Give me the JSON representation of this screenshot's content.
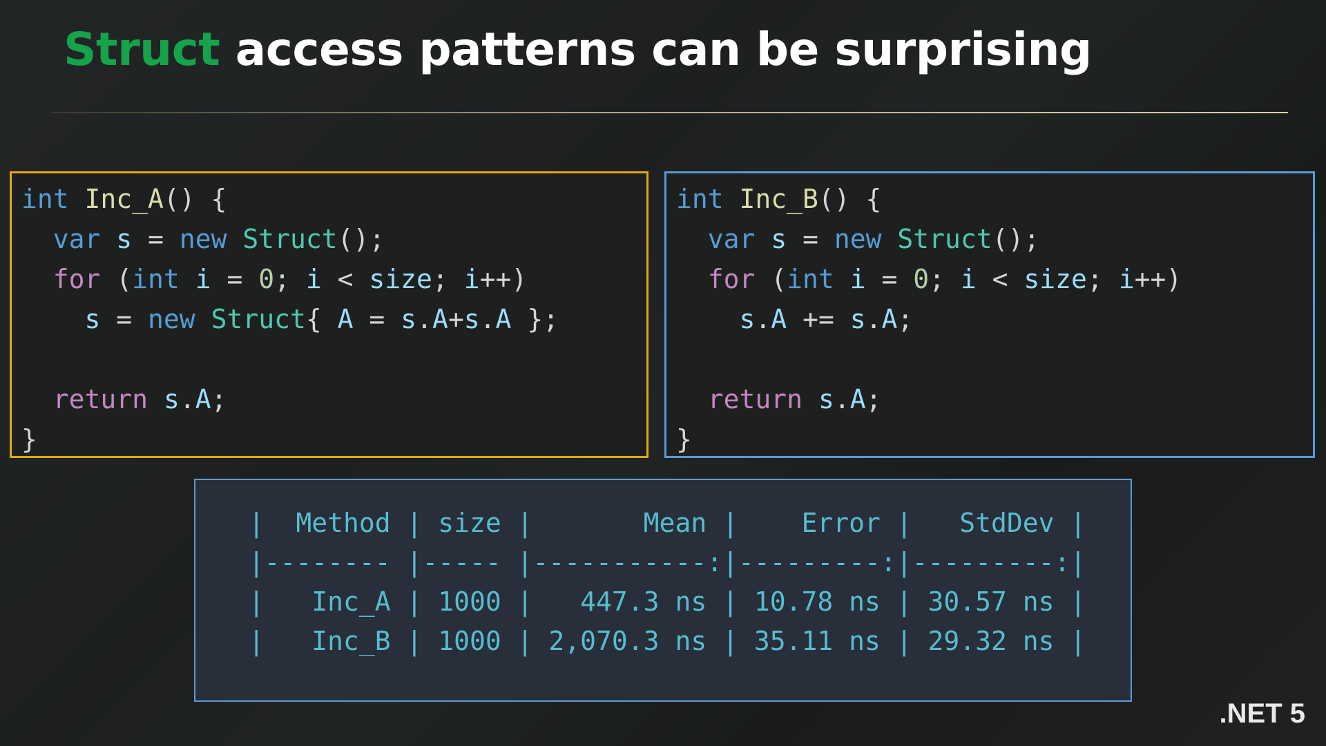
{
  "slide": {
    "background_color": "#1d1f20",
    "title": {
      "accent_text": "Struct",
      "rest_text": " access patterns can be surprising",
      "accent_color": "#16a34a",
      "text_color": "#ffffff"
    },
    "brand": ".NET 5"
  },
  "code_left": {
    "border_color": "#e3a712",
    "method_name": "Inc_A",
    "lines": [
      {
        "parts": [
          {
            "t": "int",
            "c": "kw"
          },
          {
            "t": " ",
            "c": "pun"
          },
          {
            "t": "Inc_A",
            "c": "fn"
          },
          {
            "t": "() {",
            "c": "pun"
          }
        ]
      },
      {
        "parts": [
          {
            "t": "  ",
            "c": "pun"
          },
          {
            "t": "var",
            "c": "kw"
          },
          {
            "t": " ",
            "c": "pun"
          },
          {
            "t": "s",
            "c": "id"
          },
          {
            "t": " = ",
            "c": "pun"
          },
          {
            "t": "new",
            "c": "kw"
          },
          {
            "t": " ",
            "c": "pun"
          },
          {
            "t": "Struct",
            "c": "type"
          },
          {
            "t": "();",
            "c": "pun"
          }
        ]
      },
      {
        "parts": [
          {
            "t": "  ",
            "c": "pun"
          },
          {
            "t": "for",
            "c": "ctl"
          },
          {
            "t": " (",
            "c": "pun"
          },
          {
            "t": "int",
            "c": "kw"
          },
          {
            "t": " ",
            "c": "pun"
          },
          {
            "t": "i",
            "c": "id"
          },
          {
            "t": " = ",
            "c": "pun"
          },
          {
            "t": "0",
            "c": "num"
          },
          {
            "t": "; ",
            "c": "pun"
          },
          {
            "t": "i",
            "c": "id"
          },
          {
            "t": " < ",
            "c": "pun"
          },
          {
            "t": "size",
            "c": "id"
          },
          {
            "t": "; ",
            "c": "pun"
          },
          {
            "t": "i",
            "c": "id"
          },
          {
            "t": "++)",
            "c": "pun"
          }
        ]
      },
      {
        "parts": [
          {
            "t": "    ",
            "c": "pun"
          },
          {
            "t": "s",
            "c": "id"
          },
          {
            "t": " = ",
            "c": "pun"
          },
          {
            "t": "new",
            "c": "kw"
          },
          {
            "t": " ",
            "c": "pun"
          },
          {
            "t": "Struct",
            "c": "type"
          },
          {
            "t": "{ ",
            "c": "pun"
          },
          {
            "t": "A",
            "c": "id"
          },
          {
            "t": " = ",
            "c": "pun"
          },
          {
            "t": "s",
            "c": "id"
          },
          {
            "t": ".",
            "c": "pun"
          },
          {
            "t": "A",
            "c": "id"
          },
          {
            "t": "+",
            "c": "pun"
          },
          {
            "t": "s",
            "c": "id"
          },
          {
            "t": ".",
            "c": "pun"
          },
          {
            "t": "A",
            "c": "id"
          },
          {
            "t": " };",
            "c": "pun"
          }
        ]
      },
      {
        "parts": [
          {
            "t": "",
            "c": "pun"
          }
        ]
      },
      {
        "parts": [
          {
            "t": "  ",
            "c": "pun"
          },
          {
            "t": "return",
            "c": "ctl"
          },
          {
            "t": " ",
            "c": "pun"
          },
          {
            "t": "s",
            "c": "id"
          },
          {
            "t": ".",
            "c": "pun"
          },
          {
            "t": "A",
            "c": "id"
          },
          {
            "t": ";",
            "c": "pun"
          }
        ]
      },
      {
        "parts": [
          {
            "t": "}",
            "c": "pun"
          }
        ]
      }
    ]
  },
  "code_right": {
    "border_color": "#5b9bd5",
    "method_name": "Inc_B",
    "lines": [
      {
        "parts": [
          {
            "t": "int",
            "c": "kw"
          },
          {
            "t": " ",
            "c": "pun"
          },
          {
            "t": "Inc_B",
            "c": "fn"
          },
          {
            "t": "() {",
            "c": "pun"
          }
        ]
      },
      {
        "parts": [
          {
            "t": "  ",
            "c": "pun"
          },
          {
            "t": "var",
            "c": "kw"
          },
          {
            "t": " ",
            "c": "pun"
          },
          {
            "t": "s",
            "c": "id"
          },
          {
            "t": " = ",
            "c": "pun"
          },
          {
            "t": "new",
            "c": "kw"
          },
          {
            "t": " ",
            "c": "pun"
          },
          {
            "t": "Struct",
            "c": "type"
          },
          {
            "t": "();",
            "c": "pun"
          }
        ]
      },
      {
        "parts": [
          {
            "t": "  ",
            "c": "pun"
          },
          {
            "t": "for",
            "c": "ctl"
          },
          {
            "t": " (",
            "c": "pun"
          },
          {
            "t": "int",
            "c": "kw"
          },
          {
            "t": " ",
            "c": "pun"
          },
          {
            "t": "i",
            "c": "id"
          },
          {
            "t": " = ",
            "c": "pun"
          },
          {
            "t": "0",
            "c": "num"
          },
          {
            "t": "; ",
            "c": "pun"
          },
          {
            "t": "i",
            "c": "id"
          },
          {
            "t": " < ",
            "c": "pun"
          },
          {
            "t": "size",
            "c": "id"
          },
          {
            "t": "; ",
            "c": "pun"
          },
          {
            "t": "i",
            "c": "id"
          },
          {
            "t": "++)",
            "c": "pun"
          }
        ]
      },
      {
        "parts": [
          {
            "t": "    ",
            "c": "pun"
          },
          {
            "t": "s",
            "c": "id"
          },
          {
            "t": ".",
            "c": "pun"
          },
          {
            "t": "A",
            "c": "id"
          },
          {
            "t": " += ",
            "c": "pun"
          },
          {
            "t": "s",
            "c": "id"
          },
          {
            "t": ".",
            "c": "pun"
          },
          {
            "t": "A",
            "c": "id"
          },
          {
            "t": ";",
            "c": "pun"
          }
        ]
      },
      {
        "parts": [
          {
            "t": "",
            "c": "pun"
          }
        ]
      },
      {
        "parts": [
          {
            "t": "  ",
            "c": "pun"
          },
          {
            "t": "return",
            "c": "ctl"
          },
          {
            "t": " ",
            "c": "pun"
          },
          {
            "t": "s",
            "c": "id"
          },
          {
            "t": ".",
            "c": "pun"
          },
          {
            "t": "A",
            "c": "id"
          },
          {
            "t": ";",
            "c": "pun"
          }
        ]
      },
      {
        "parts": [
          {
            "t": "}",
            "c": "pun"
          }
        ]
      }
    ]
  },
  "benchmark": {
    "border_color": "#5b9bd5",
    "background_color": "#282e3a",
    "text_color": "#55bece",
    "columns": [
      "Method",
      "size",
      "Mean",
      "Error",
      "StdDev"
    ],
    "separator_row": [
      "-------",
      "-----",
      "-----------:",
      "---------:",
      "---------:"
    ],
    "rows": [
      {
        "Method": "Inc_A",
        "size": "1000",
        "Mean": "447.3 ns",
        "Error": "10.78 ns",
        "StdDev": "30.57 ns"
      },
      {
        "Method": "Inc_B",
        "size": "1000",
        "Mean": "2,070.3 ns",
        "Error": "35.11 ns",
        "StdDev": "29.32 ns"
      }
    ],
    "rendered_text": "|  Method | size |       Mean |    Error |   StdDev |\n|-------- |----- |-----------:|---------:|---------:|\n|   Inc_A | 1000 |   447.3 ns | 10.78 ns | 30.57 ns |\n|   Inc_B | 1000 | 2,070.3 ns | 35.11 ns | 29.32 ns |"
  },
  "chart_data": {
    "type": "table",
    "title": "BenchmarkDotNet results",
    "columns": [
      "Method",
      "size",
      "Mean",
      "Error",
      "StdDev"
    ],
    "units": "ns",
    "rows": [
      [
        "Inc_A",
        1000,
        447.3,
        10.78,
        30.57
      ],
      [
        "Inc_B",
        1000,
        2070.3,
        35.11,
        29.32
      ]
    ]
  }
}
